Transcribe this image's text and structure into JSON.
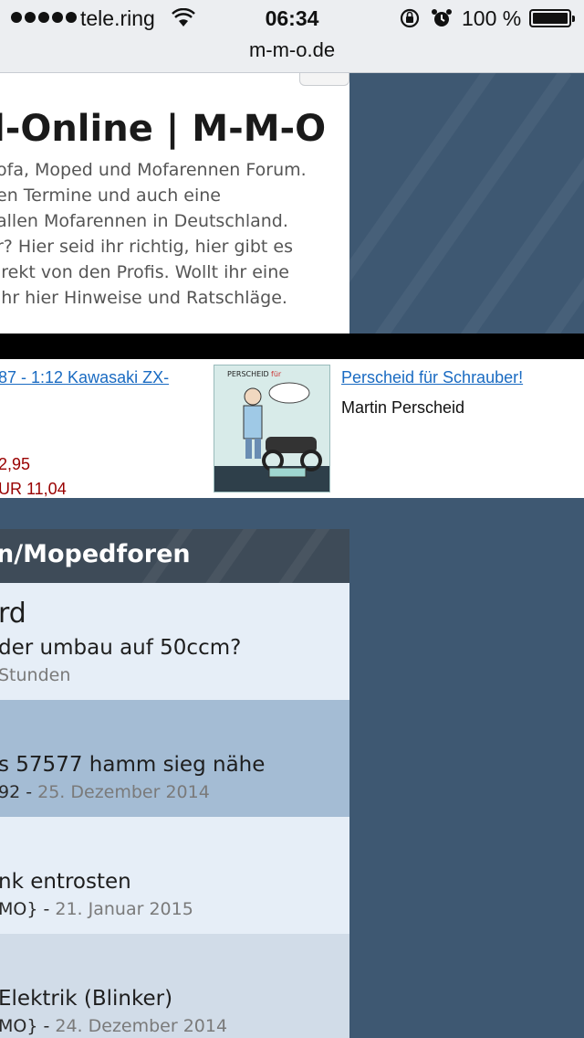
{
  "status_bar": {
    "carrier": "tele.ring",
    "time": "06:34",
    "battery": "100 %",
    "icons": [
      "signal-dots",
      "wifi-icon",
      "rotation-lock-icon",
      "alarm-icon",
      "battery-icon"
    ]
  },
  "url_bar": {
    "domain": "m-m-o.de"
  },
  "header": {
    "title": "l-Online | M-M-O",
    "description_lines": [
      "ofa, Moped und Mofarennen Forum.",
      "en Termine und auch eine",
      "allen Mofarennen in Deutschland.",
      "r? Hier seid ihr richtig, hier gibt es",
      "irekt von den Profis. Wollt ihr eine",
      "ihr hier Hinweise und Ratschläge."
    ]
  },
  "ads": [
    {
      "link": "87 - 1:12 Kawasaki ZX-",
      "price1": "2,95",
      "price2": "UR 11,04"
    },
    {
      "image": "book-cover",
      "link": "Perscheid für Schrauber!",
      "author": "Martin Perscheid"
    }
  ],
  "forum": {
    "section_title": "n/Mopedforen",
    "rows": [
      {
        "big": "rd",
        "topic": "der umbau auf 50ccm?",
        "author": "",
        "date": "Stunden",
        "bg": "#e6eef7"
      },
      {
        "big": "",
        "topic": "s 57577 hamm sieg nähe",
        "author": "92",
        "date": "25. Dezember 2014",
        "bg": "#a4bcd4"
      },
      {
        "big": "",
        "topic": "nk entrosten",
        "author": "MO}",
        "date": "21. Januar 2015",
        "bg": "#e6eef7"
      },
      {
        "big": "",
        "topic": "Elektrik (Blinker)",
        "author": "MO}",
        "date": "24. Dezember 2014",
        "bg": "#d1dce8"
      }
    ]
  },
  "colors": {
    "page_bg": "#3e5872",
    "forum_header": "#3e4b58",
    "link": "#1a6bc2",
    "price": "#990000"
  }
}
